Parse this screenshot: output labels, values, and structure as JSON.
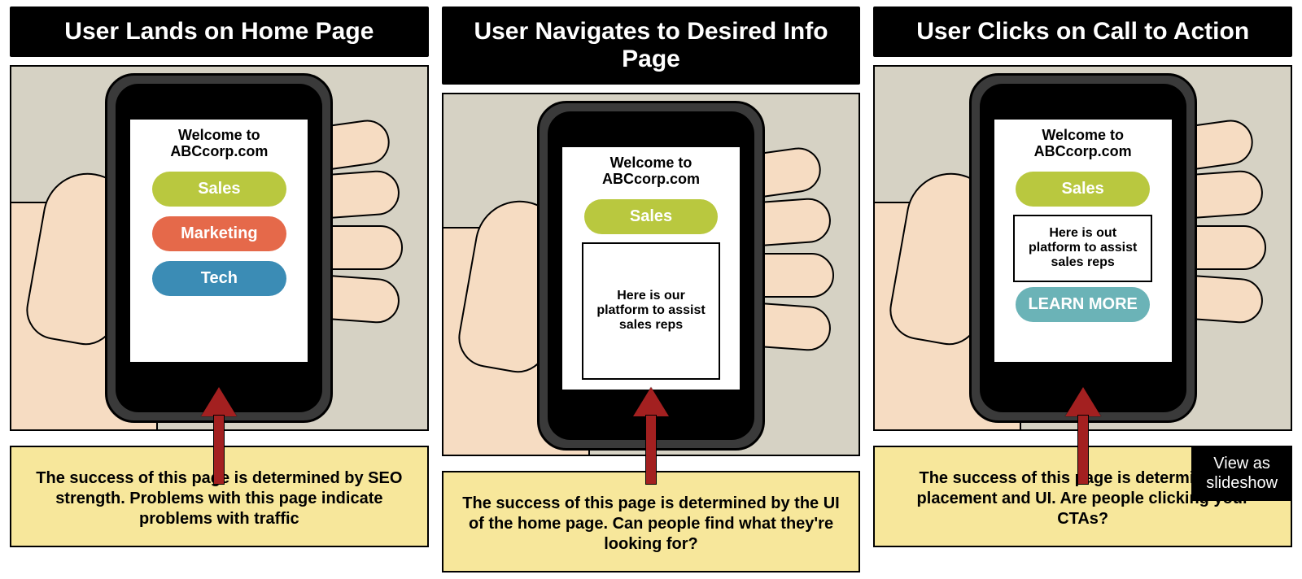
{
  "slideshow_button": "View as\nslideshow",
  "panels": [
    {
      "header": "User Lands on Home Page",
      "screen": {
        "welcome": "Welcome to\nABCcorp.com",
        "layout": "three-pills",
        "pills": [
          {
            "label": "Sales",
            "color": "green"
          },
          {
            "label": "Marketing",
            "color": "orange"
          },
          {
            "label": "Tech",
            "color": "blue"
          }
        ]
      },
      "caption": "The success of this page is determined by SEO strength. Problems with this page indicate problems with traffic"
    },
    {
      "header": "User Navigates to Desired Info Page",
      "screen": {
        "welcome": "Welcome to\nABCcorp.com",
        "layout": "pill-plus-tall-box",
        "pill": {
          "label": "Sales",
          "color": "green"
        },
        "box_text": "Here is our platform to assist sales reps"
      },
      "caption": "The success of this page is determined by the UI of the home page. Can people find what they're looking for?"
    },
    {
      "header": "User Clicks on Call to Action",
      "screen": {
        "welcome": "Welcome to\nABCcorp.com",
        "layout": "pill-box-cta",
        "pill": {
          "label": "Sales",
          "color": "green"
        },
        "box_text": "Here is out platform to assist sales reps",
        "cta": {
          "label": "LEARN MORE",
          "color": "teal"
        }
      },
      "caption": "The success of this page is determined by placement and UI. Are people clicking your CTAs?"
    }
  ]
}
